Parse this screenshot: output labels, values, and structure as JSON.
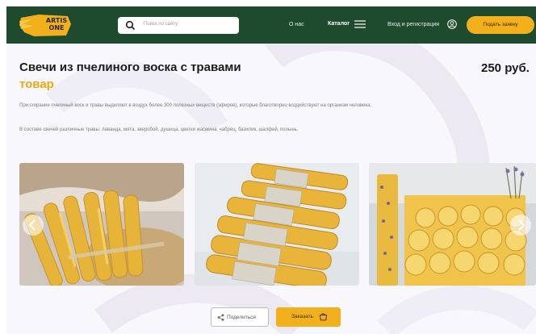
{
  "header": {
    "logo_text_line1": "ARTIS",
    "logo_text_line2": "ONE",
    "search_placeholder": "Поиск по сайту",
    "nav_about": "О нас",
    "nav_catalog": "Каталог",
    "nav_login": "Вход и регистрация",
    "apply_button": "Подать заявку"
  },
  "product": {
    "title": "Свечи из пчелиного воска с травами",
    "tag": "товар",
    "price": "250 руб.",
    "description_1": "При сгорании пчелиный воск и травы выделяют в воздух более 300 полезных веществ (эфиров), которые благотворно воздействуют на организм человека.",
    "description_2": "В составе свечей различные травы: лаванда, мята, зверобой, душица, цветки жасмина, чабрец, базилик, шалфей, полынь."
  },
  "gallery": {
    "photos": [
      "rolled-honeycomb-candles-basket",
      "tied-candle-bundles",
      "honeycomb-pillar-and-herb-candles"
    ]
  },
  "actions": {
    "share_label": "Поделиться",
    "order_label": "Заказать"
  },
  "colors": {
    "header_bg": "#1e4b2e",
    "accent": "#f2b01d",
    "tag_color": "#e9a814"
  },
  "icons": [
    "logo-icon",
    "search-icon",
    "menu-icon",
    "user-icon",
    "arrow-left-icon",
    "arrow-right-icon",
    "share-icon",
    "cart-icon"
  ]
}
